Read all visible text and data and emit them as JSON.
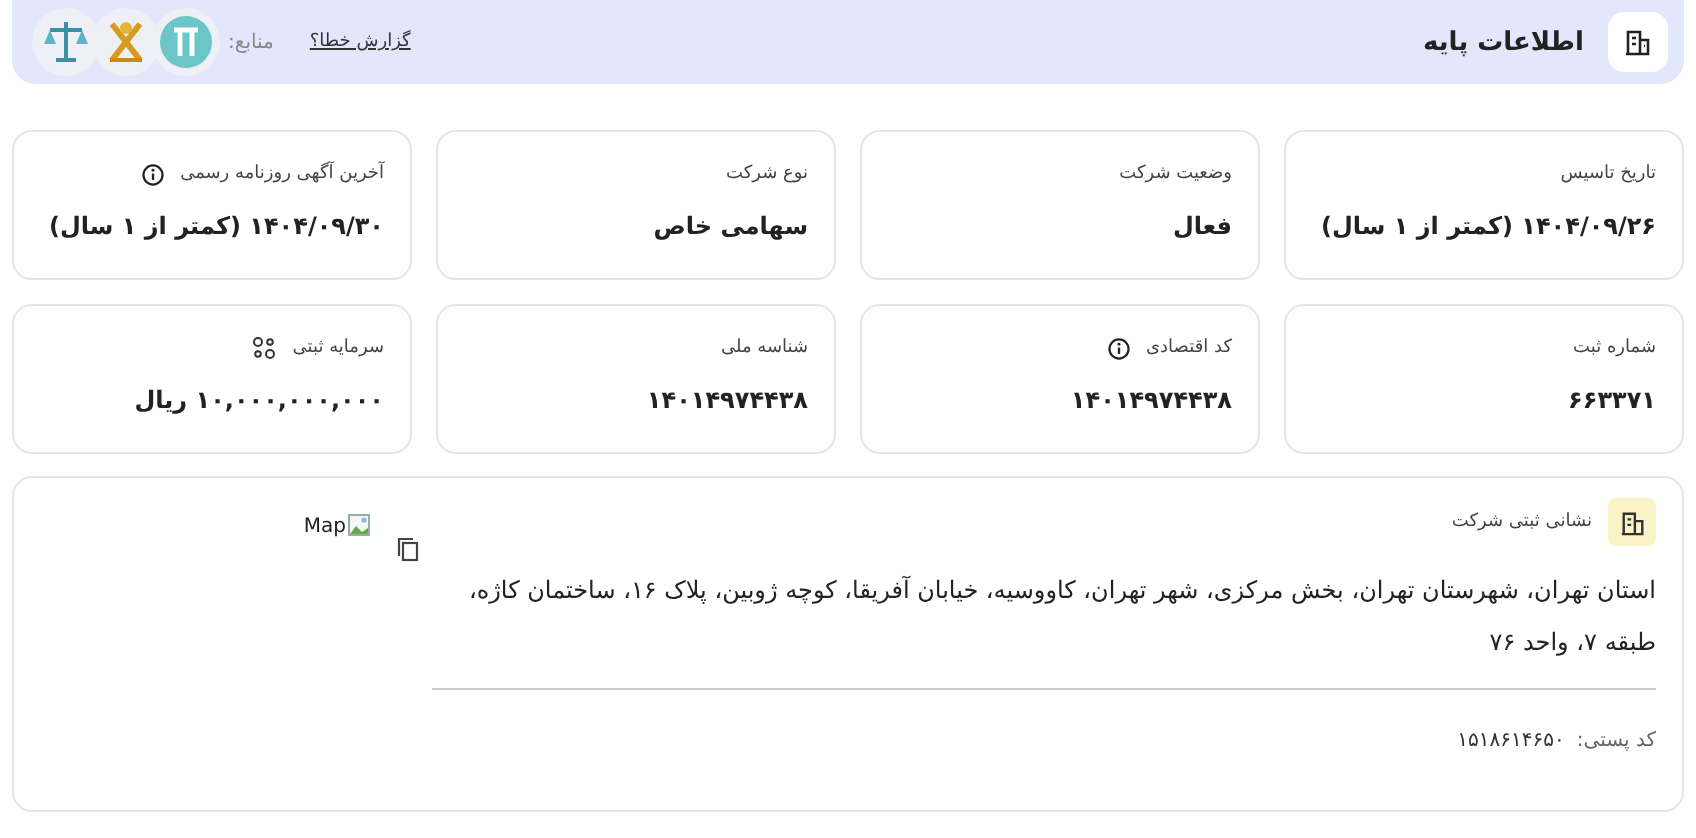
{
  "header": {
    "title": "اطلاعات پایه",
    "report_link": "گزارش خطا؟",
    "sources_label": "منابع:",
    "sources": [
      {
        "kind": "circle"
      },
      {
        "kind": "emblem"
      },
      {
        "kind": "scales"
      }
    ]
  },
  "cards": [
    {
      "label": "تاریخ تاسیس",
      "value": "۱۴۰۴/۰۹/۲۶ (کمتر از ۱ سال)"
    },
    {
      "label": "وضعیت شرکت",
      "value": "فعال"
    },
    {
      "label": "نوع شرکت",
      "value": "سهامی خاص"
    },
    {
      "label": "آخرین آگهی روزنامه رسمی",
      "value": "۱۴۰۴/۰۹/۳۰ (کمتر از ۱ سال)",
      "kind": "info"
    },
    {
      "label": "شماره ثبت",
      "value": "۶۶۳۳۷۱"
    },
    {
      "label": "کد اقتصادی",
      "value": "۱۴۰۱۴۹۷۴۴۳۸",
      "kind": "info"
    },
    {
      "label": "شناسه ملی",
      "value": "۱۴۰۱۴۹۷۴۴۳۸"
    },
    {
      "label": "سرمایه ثبتی",
      "value": "۱۰,۰۰۰,۰۰۰,۰۰۰ ریال",
      "kind": "coins"
    }
  ],
  "address": {
    "title": "نشانی ثبتی شرکت",
    "text": "استان تهران، شهرستان تهران، بخش مرکزی، شهر تهران، کاووسیه، خیابان آفریقا، کوچه ژوبین، پلاک ۱۶، ساختمان کاژه، طبقه ۷، واحد ۷۶",
    "postal_label": "کد پستی:",
    "postal_code": "۱۵۱۸۶۱۴۶۵۰",
    "map_alt": "Map"
  }
}
